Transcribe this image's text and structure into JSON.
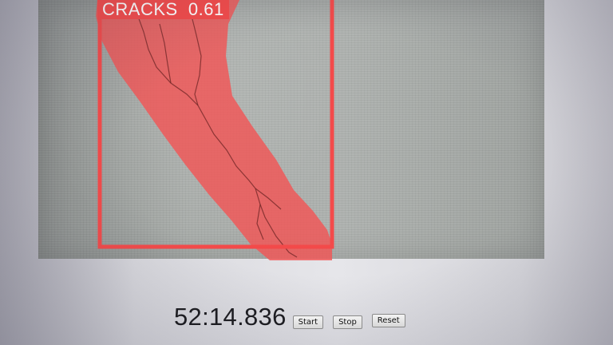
{
  "detection": {
    "label": "CRACKS  0.61",
    "box_color": "#f34a4a",
    "mask_color": "#f25656"
  },
  "stopwatch": {
    "time": "52:14.836",
    "start_label": "Start",
    "stop_label": "Stop",
    "reset_label": "Reset"
  }
}
